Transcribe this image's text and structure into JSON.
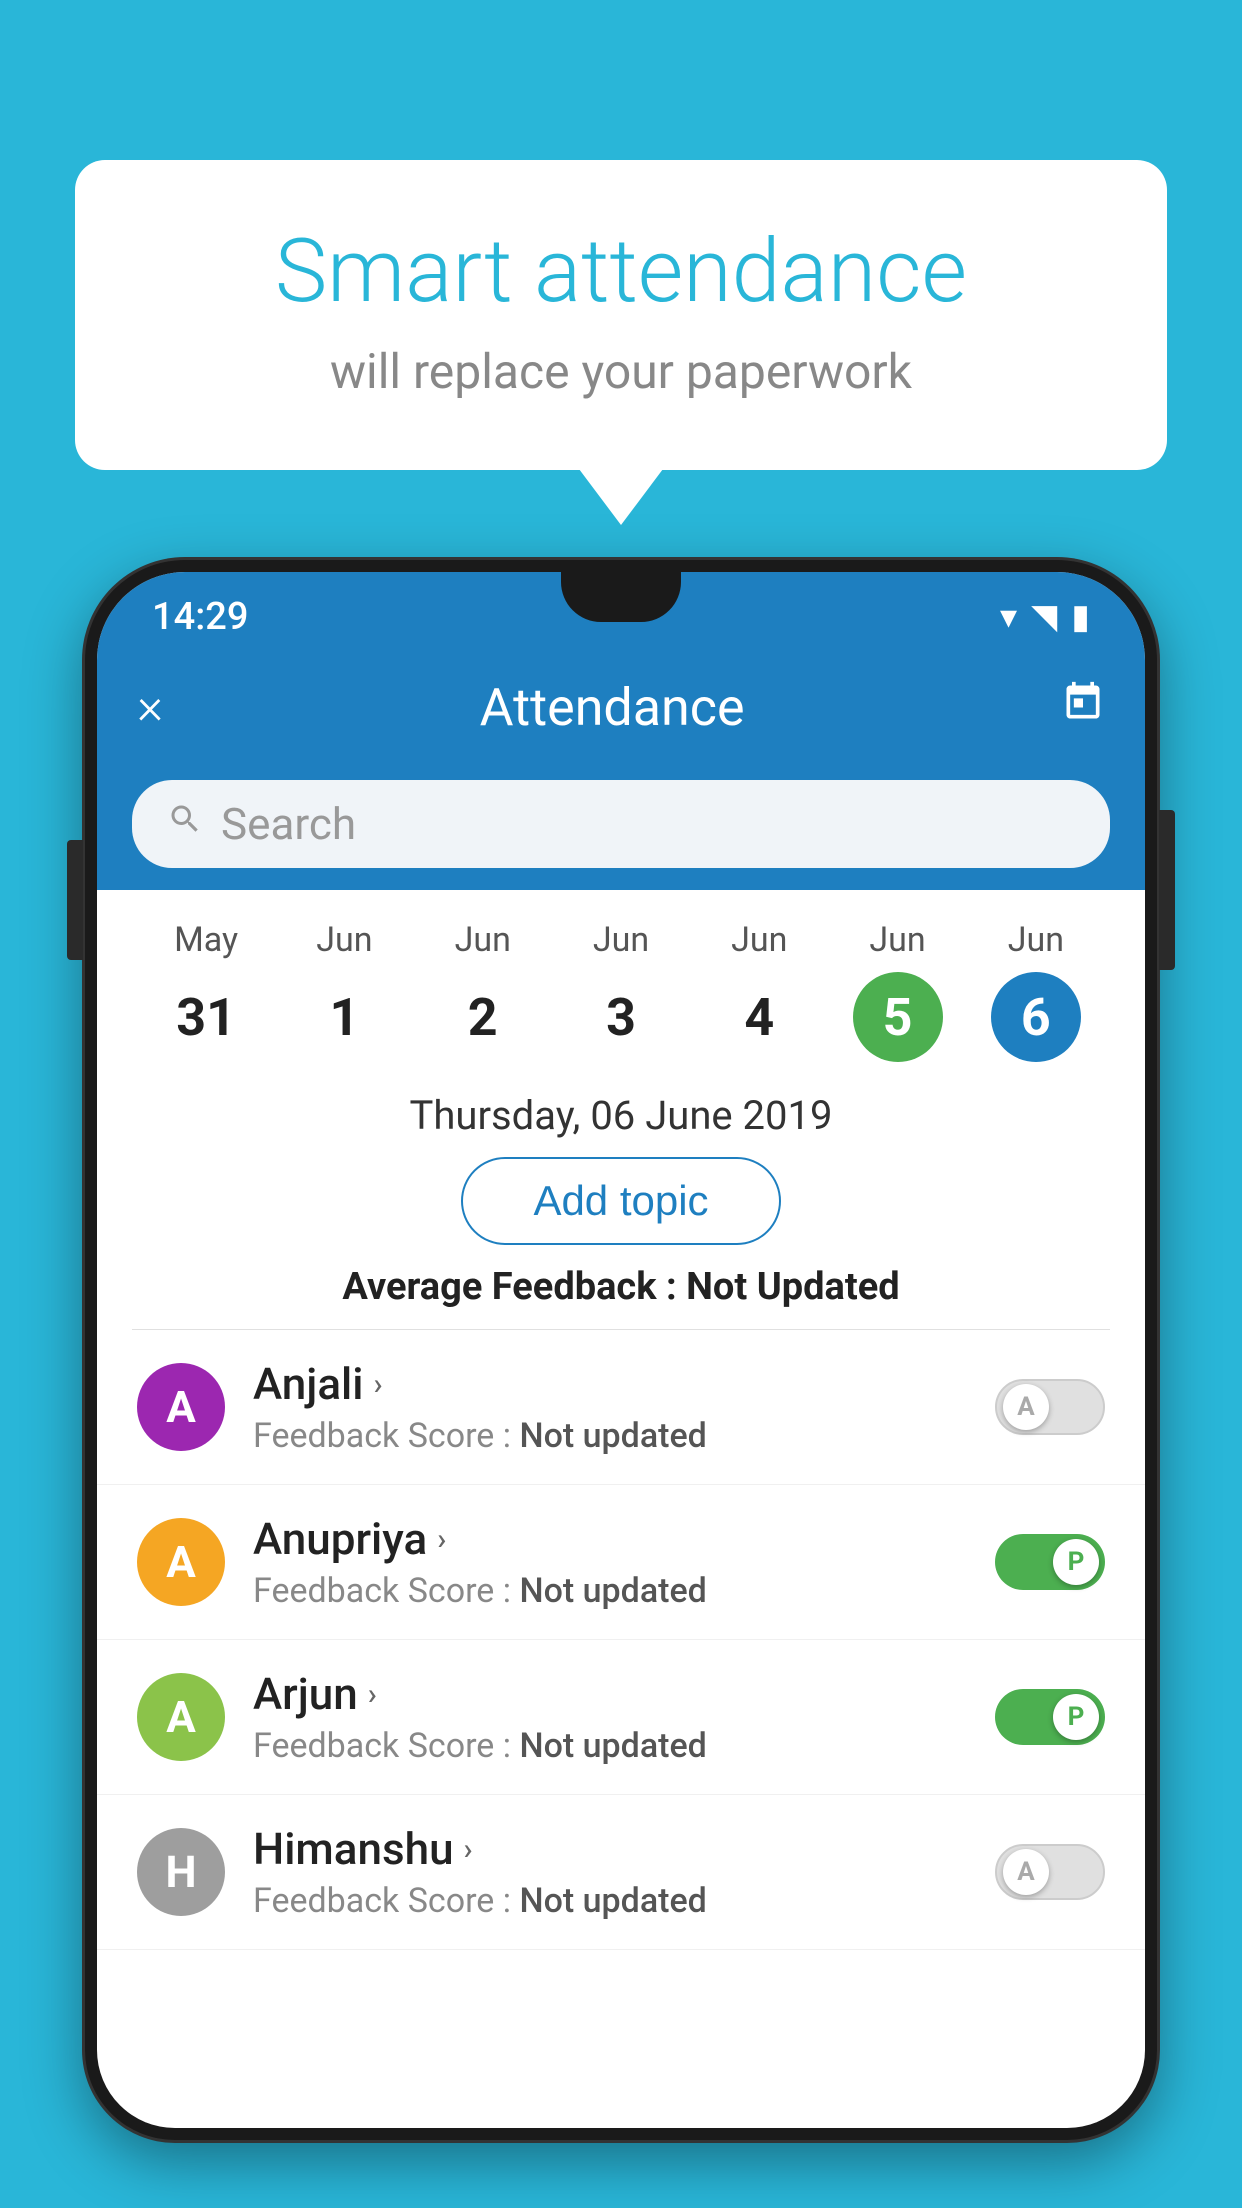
{
  "background_color": "#29b6d8",
  "bubble": {
    "title": "Smart attendance",
    "subtitle": "will replace your paperwork"
  },
  "status_bar": {
    "time": "14:29"
  },
  "app_bar": {
    "title": "Attendance",
    "close_label": "×",
    "calendar_icon": "📅"
  },
  "search": {
    "placeholder": "Search"
  },
  "calendar": {
    "months": [
      "May",
      "Jun",
      "Jun",
      "Jun",
      "Jun",
      "Jun",
      "Jun"
    ],
    "days": [
      "31",
      "1",
      "2",
      "3",
      "4",
      "5",
      "6"
    ],
    "states": [
      "normal",
      "normal",
      "normal",
      "normal",
      "normal",
      "today",
      "selected"
    ]
  },
  "selected_date": {
    "label": "Thursday, 06 June 2019"
  },
  "add_topic": {
    "label": "Add topic"
  },
  "avg_feedback": {
    "label": "Average Feedback : ",
    "value": "Not Updated"
  },
  "students": [
    {
      "name": "Anjali",
      "avatar_letter": "A",
      "avatar_color": "#9c27b0",
      "feedback": "Not updated",
      "toggle_state": "off",
      "toggle_label": "A"
    },
    {
      "name": "Anupriya",
      "avatar_letter": "A",
      "avatar_color": "#f5a623",
      "feedback": "Not updated",
      "toggle_state": "on",
      "toggle_label": "P"
    },
    {
      "name": "Arjun",
      "avatar_letter": "A",
      "avatar_color": "#8bc34a",
      "feedback": "Not updated",
      "toggle_state": "on",
      "toggle_label": "P"
    },
    {
      "name": "Himanshu",
      "avatar_letter": "H",
      "avatar_color": "#9e9e9e",
      "feedback": "Not updated",
      "toggle_state": "off",
      "toggle_label": "A"
    }
  ],
  "feedback_label_prefix": "Feedback Score : "
}
